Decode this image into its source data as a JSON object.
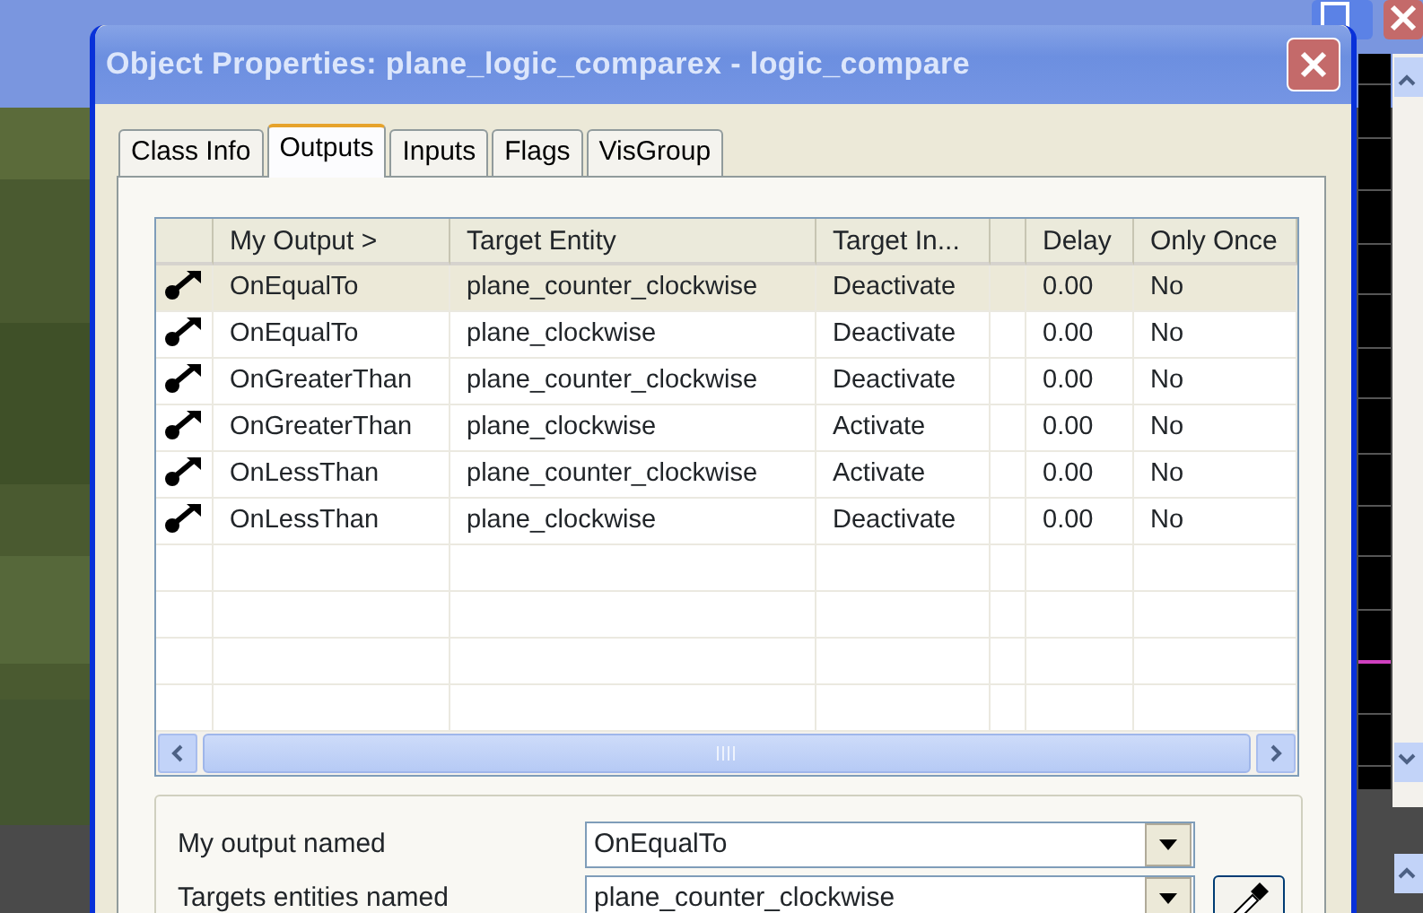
{
  "window": {
    "title": "Object Properties: plane_logic_comparex - logic_compare"
  },
  "tabs": [
    {
      "label": "Class Info",
      "selected": false
    },
    {
      "label": "Outputs",
      "selected": true
    },
    {
      "label": "Inputs",
      "selected": false
    },
    {
      "label": "Flags",
      "selected": false
    },
    {
      "label": "VisGroup",
      "selected": false
    }
  ],
  "table": {
    "columns": [
      "My Output  >",
      "Target Entity",
      "Target In...",
      "",
      "Delay",
      "Only Once"
    ],
    "rows": [
      {
        "selected": true,
        "cells": [
          "OnEqualTo",
          "plane_counter_clockwise",
          "Deactivate",
          "",
          "0.00",
          "No"
        ]
      },
      {
        "selected": false,
        "cells": [
          "OnEqualTo",
          "plane_clockwise",
          "Deactivate",
          "",
          "0.00",
          "No"
        ]
      },
      {
        "selected": false,
        "cells": [
          "OnGreaterThan",
          "plane_counter_clockwise",
          "Deactivate",
          "",
          "0.00",
          "No"
        ]
      },
      {
        "selected": false,
        "cells": [
          "OnGreaterThan",
          "plane_clockwise",
          "Activate",
          "",
          "0.00",
          "No"
        ]
      },
      {
        "selected": false,
        "cells": [
          "OnLessThan",
          "plane_counter_clockwise",
          "Activate",
          "",
          "0.00",
          "No"
        ]
      },
      {
        "selected": false,
        "cells": [
          "OnLessThan",
          "plane_clockwise",
          "Deactivate",
          "",
          "0.00",
          "No"
        ]
      }
    ]
  },
  "fields": [
    {
      "label": "My output named",
      "value": "OnEqualTo",
      "kind": "combo"
    },
    {
      "label": "Targets entities named",
      "value": "plane_counter_clockwise",
      "kind": "combo-picker"
    }
  ]
}
